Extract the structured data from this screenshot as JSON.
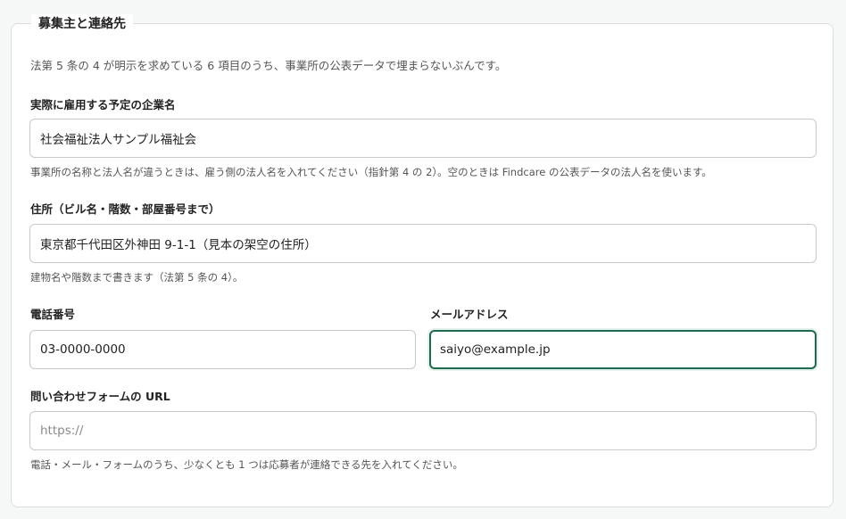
{
  "section": {
    "title": "募集主と連絡先",
    "intro": "法第 5 条の 4 が明示を求めている 6 項目のうち、事業所の公表データで埋まらないぶんです。"
  },
  "fields": {
    "company": {
      "label": "実際に雇用する予定の企業名",
      "value": "社会福祉法人サンプル福祉会",
      "help": "事業所の名称と法人名が違うときは、雇う側の法人名を入れてください（指針第 4 の 2）。空のときは Findcare の公表データの法人名を使います。"
    },
    "address": {
      "label": "住所（ビル名・階数・部屋番号まで）",
      "value": "東京都千代田区外神田 9-1-1（見本の架空の住所）",
      "help": "建物名や階数まで書きます（法第 5 条の 4）。"
    },
    "phone": {
      "label": "電話番号",
      "value": "03-0000-0000"
    },
    "email": {
      "label": "メールアドレス",
      "value": "saiyo@example.jp"
    },
    "url": {
      "label": "問い合わせフォームの URL",
      "value": "",
      "placeholder": "https://",
      "help": "電話・メール・フォームのうち、少なくとも 1 つは応募者が連絡できる先を入れてください。"
    }
  },
  "colors": {
    "focus_border": "#1b6b4e",
    "border": "#c9c9c9",
    "background": "#f6f7f7"
  }
}
